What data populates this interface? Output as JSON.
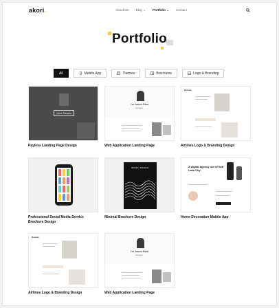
{
  "header": {
    "logo": "akori",
    "logo_dot": ".",
    "nav": [
      "About Me",
      "Blog ⌄",
      "Portfolio ⌄",
      "Contact"
    ],
    "active_index": 2,
    "search_icon": "search-icon"
  },
  "page": {
    "title": "Portfolio"
  },
  "filters": [
    {
      "label": "All",
      "icon": ""
    },
    {
      "label": "Mobile App",
      "icon": "phone-icon"
    },
    {
      "label": "Themes",
      "icon": "grid-icon"
    },
    {
      "label": "Brochures",
      "icon": "book-icon"
    },
    {
      "label": "Logo & Branding",
      "icon": "image-icon"
    }
  ],
  "items": [
    {
      "caption": "Payless Landing Page Design",
      "overlay": "View Details"
    },
    {
      "caption": "Web Application Landing Page",
      "hero_text": "I'm Jason Reid",
      "hero_sub": "Designer"
    },
    {
      "caption": "Airlines Logo & Branding Design",
      "brand": "Dorisiq"
    },
    {
      "caption": "Professional Social Media Service Brochure Design"
    },
    {
      "caption": "Minimal Brochure Design",
      "cover": "BOOK WAVES"
    },
    {
      "caption": "Home Decoration Mobile App",
      "headline": "A digital agency out of Salt Lake City"
    },
    {
      "caption": "Airlines Logo & Branding Design",
      "brand": "Dorisiq"
    },
    {
      "caption": "Web Application Landing Page",
      "hero_text": "I'm Jason Reid",
      "hero_sub": "Designer"
    }
  ],
  "colors": {
    "accent": "#f7cd3f",
    "dark": "#111111",
    "muted": "#666666"
  }
}
